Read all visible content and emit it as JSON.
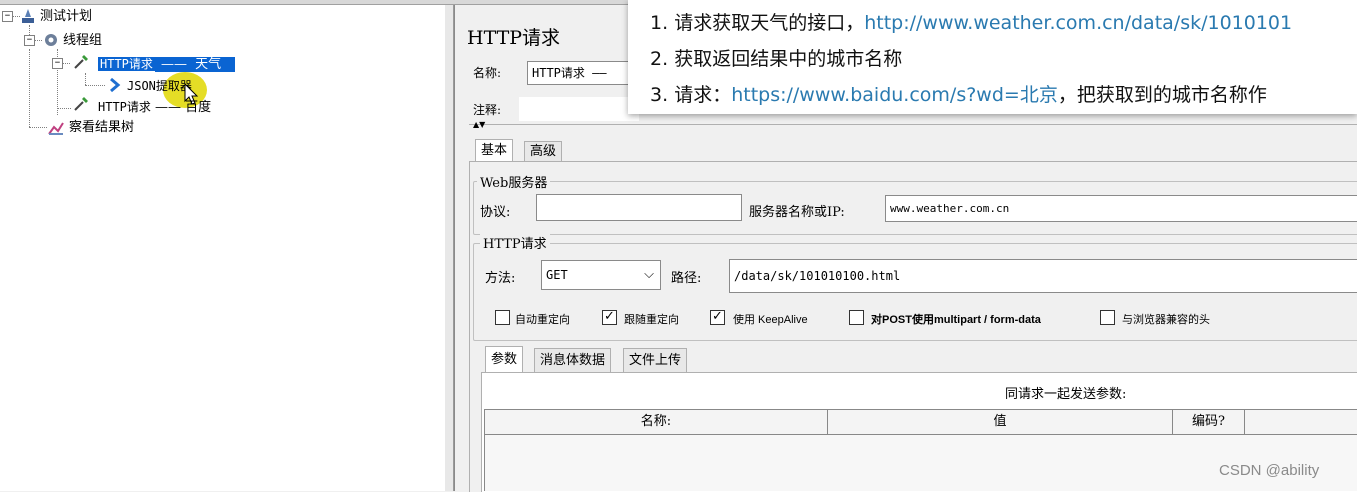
{
  "tree": {
    "root_label": "测试计划",
    "thread_group_label": "线程组",
    "http_request_1_label": "HTTP请求",
    "http_request_1_annotation": "天气",
    "json_extractor_label": "JSON提取器",
    "http_request_2_label": "HTTP请求",
    "http_request_2_annotation": "百度",
    "result_tree_label": "察看结果树",
    "selected_color": "#0a64d2"
  },
  "editor": {
    "title": "HTTP请求",
    "name_label": "名称:",
    "name_value": "HTTP请求 ——",
    "comment_label": "注释:",
    "tabs": [
      "基本",
      "高级"
    ],
    "web_server_group": "Web服务器",
    "protocol_label": "协议:",
    "protocol_value": "",
    "server_label": "服务器名称或IP:",
    "server_value": "www.weather.com.cn",
    "http_request_group": "HTTP请求",
    "method_label": "方法:",
    "method_value": "GET",
    "path_label": "路径:",
    "path_value": "/data/sk/101010100.html",
    "checkboxes": [
      {
        "label": "自动重定向",
        "checked": false
      },
      {
        "label": "跟随重定向",
        "checked": true
      },
      {
        "label": "使用 KeepAlive",
        "checked": true
      },
      {
        "label": "对POST使用multipart / form-data",
        "checked": false
      },
      {
        "label": "与浏览器兼容的头",
        "checked": false
      }
    ],
    "param_tabs": [
      "参数",
      "消息体数据",
      "文件上传"
    ],
    "params_caption": "同请求一起发送参数:",
    "table_headers": [
      "名称:",
      "值",
      "编码?"
    ]
  },
  "overlay": {
    "line1_prefix": "请求获取天气的接口，",
    "line1_link": "http://www.weather.com.cn/data/sk/1010101",
    "line2": "获取返回结果中的城市名称",
    "line3_prefix": "请求：",
    "line3_link": "https://www.baidu.com/s?wd=北京",
    "line3_suffix": "，把获取到的城市名称作",
    "numbers": [
      "1.",
      "2.",
      "3."
    ],
    "link_color": "#2a7ab0"
  },
  "watermark": "CSDN @ability"
}
